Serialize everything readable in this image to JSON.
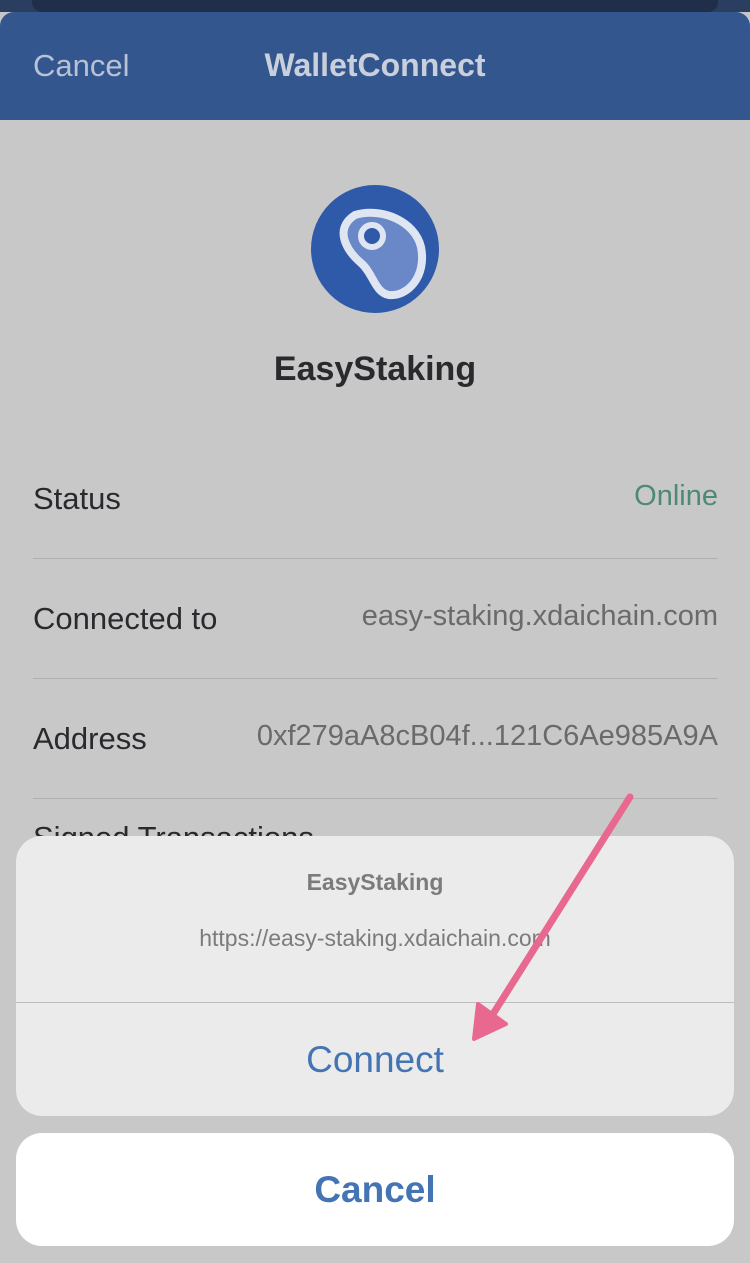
{
  "header": {
    "cancel_label": "Cancel",
    "title": "WalletConnect"
  },
  "app": {
    "name": "EasyStaking"
  },
  "details": [
    {
      "label": "Status",
      "value": "Online"
    },
    {
      "label": "Connected to",
      "value": "easy-staking.xdaichain.com"
    },
    {
      "label": "Address",
      "value": "0xf279aA8cB04f...121C6Ae985A9A"
    }
  ],
  "partial_row": {
    "label": "Signed Transactions"
  },
  "action_sheet": {
    "title": "EasyStaking",
    "message": "https://easy-staking.xdaichain.com",
    "connect_label": "Connect",
    "cancel_label": "Cancel"
  },
  "colors": {
    "navbar": "#34568f",
    "accent": "#4474b4",
    "online": "#4c8a74",
    "annotation_arrow": "#e8688f"
  },
  "icons": [
    "app-logo-icon",
    "chevron-right-icon",
    "annotation-arrow"
  ]
}
